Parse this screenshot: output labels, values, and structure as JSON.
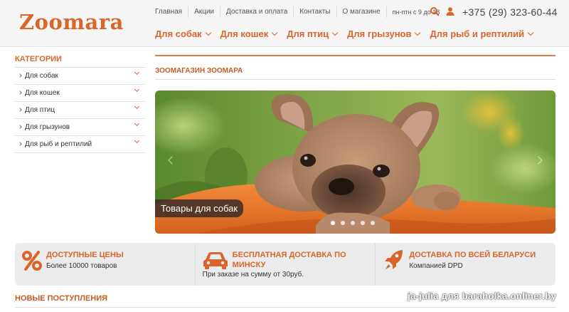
{
  "header": {
    "logo": "Zoomara",
    "top_links": [
      "Главная",
      "Акции",
      "Доставка и оплата",
      "Контакты",
      "О магазине"
    ],
    "hours": "пн-птн с 9 до 18",
    "phone": "+375 (29) 323-60-44",
    "nav": [
      "Для собак",
      "Для кошек",
      "Для птиц",
      "Для грызунов",
      "Для рыб и рептилий"
    ]
  },
  "sidebar": {
    "title": "КАТЕГОРИИ",
    "items": [
      "Для собак",
      "Для кошек",
      "Для птиц",
      "Для грызунов",
      "Для рыб и рептилий"
    ]
  },
  "main": {
    "section_title": "ЗООМАГАЗИН ЗООМАРА",
    "slider": {
      "caption": "Товары для собак",
      "slide_count": 5,
      "active_slide": 1
    }
  },
  "features": [
    {
      "title": "ДОСТУПНЫЕ ЦЕНЫ",
      "subtitle": "Более 10000 товаров",
      "icon": "percent-icon"
    },
    {
      "title_line1": "БЕСПЛАТНАЯ ДОСТАВКА ПО",
      "title_line2": "МИНСКУ",
      "subtitle": "При заказе на сумму от 30руб.",
      "icon": "car-icon"
    },
    {
      "title": "ДОСТАВКА ПО ВСЕЙ БЕЛАРУСИ",
      "subtitle": "Компанией DPD",
      "icon": "rocket-icon"
    }
  ],
  "new_arrivals_title": "НОВЫЕ ПОСТУПЛЕНИЯ",
  "watermark": "ja-julia для baraholka.onliner.by",
  "colors": {
    "accent": "#d9652b",
    "header_bg": "#f5f5f5",
    "feature_bg": "#ececec"
  }
}
